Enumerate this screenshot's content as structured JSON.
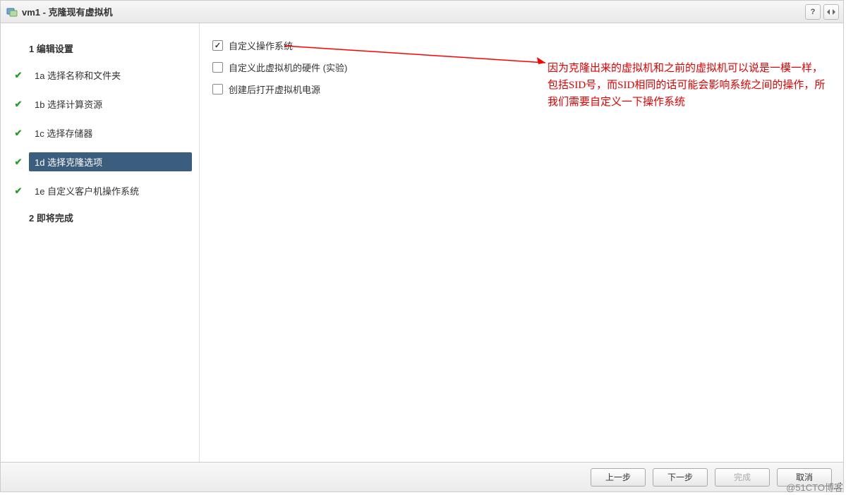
{
  "header": {
    "title": "vm1 - 克隆现有虚拟机"
  },
  "sidebar": {
    "majors": [
      {
        "num": "1",
        "label": "编辑设置"
      },
      {
        "num": "2",
        "label": "即将完成"
      }
    ],
    "subs": [
      {
        "id": "1a",
        "label": "选择名称和文件夹",
        "done": true,
        "active": false
      },
      {
        "id": "1b",
        "label": "选择计算资源",
        "done": true,
        "active": false
      },
      {
        "id": "1c",
        "label": "选择存储器",
        "done": true,
        "active": false
      },
      {
        "id": "1d",
        "label": "选择克隆选项",
        "done": true,
        "active": true
      },
      {
        "id": "1e",
        "label": "自定义客户机操作系统",
        "done": true,
        "active": false
      }
    ]
  },
  "options": [
    {
      "label": "自定义操作系统",
      "checked": true
    },
    {
      "label": "自定义此虚拟机的硬件 (实验)",
      "checked": false
    },
    {
      "label": "创建后打开虚拟机电源",
      "checked": false
    }
  ],
  "annotation": "因为克隆出来的虚拟机和之前的虚拟机可以说是一模一样，包括SID号，而SID相同的话可能会影响系统之间的操作，所我们需要自定义一下操作系统",
  "footer": {
    "back": "上一步",
    "next": "下一步",
    "finish": "完成",
    "cancel": "取消"
  },
  "watermark": "@51CTO博客"
}
